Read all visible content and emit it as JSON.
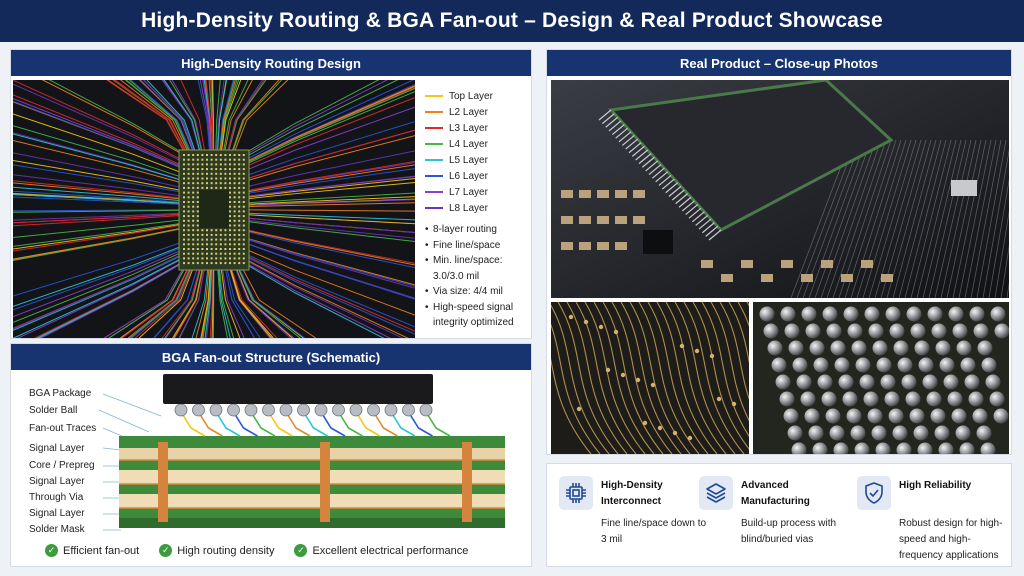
{
  "header": {
    "title": "High-Density Routing & BGA Fan-out – Design & Real Product Showcase"
  },
  "routing": {
    "title": "High-Density Routing Design",
    "legend": [
      {
        "label": "Top Layer",
        "color": "#f5c518"
      },
      {
        "label": "L2 Layer",
        "color": "#f0801e"
      },
      {
        "label": "L3 Layer",
        "color": "#e02b2b"
      },
      {
        "label": "L4 Layer",
        "color": "#49b649"
      },
      {
        "label": "L5 Layer",
        "color": "#2ec4d6"
      },
      {
        "label": "L6 Layer",
        "color": "#2a56d8"
      },
      {
        "label": "L7 Layer",
        "color": "#8a3fd0"
      },
      {
        "label": "L8 Layer",
        "color": "#6a35b8"
      }
    ],
    "bullets": [
      "8-layer routing",
      "Fine line/space",
      "Min. line/space: 3.0/3.0 mil",
      "Via size: 4/4 mil",
      "High-speed signal integrity optimized"
    ]
  },
  "fanout": {
    "title": "BGA Fan-out Structure (Schematic)",
    "labels": [
      "BGA Package",
      "Solder Ball",
      "Fan-out Traces",
      "Signal Layer",
      "Core / Prepreg",
      "Signal Layer",
      "Through Via",
      "Signal Layer",
      "Solder Mask"
    ],
    "checks": [
      "Efficient fan-out",
      "High routing density",
      "Excellent electrical performance"
    ]
  },
  "photos": {
    "title": "Real Product – Close-up Photos"
  },
  "features": [
    {
      "icon": "chip-icon",
      "title": "High-Density Interconnect",
      "desc": "Fine line/space down to 3 mil"
    },
    {
      "icon": "layers-icon",
      "title": "Advanced Manufacturing",
      "desc": "Build-up process with blind/buried vias"
    },
    {
      "icon": "shield-check-icon",
      "title": "High Reliability",
      "desc": "Robust design for high-speed and high-frequency applications"
    }
  ]
}
